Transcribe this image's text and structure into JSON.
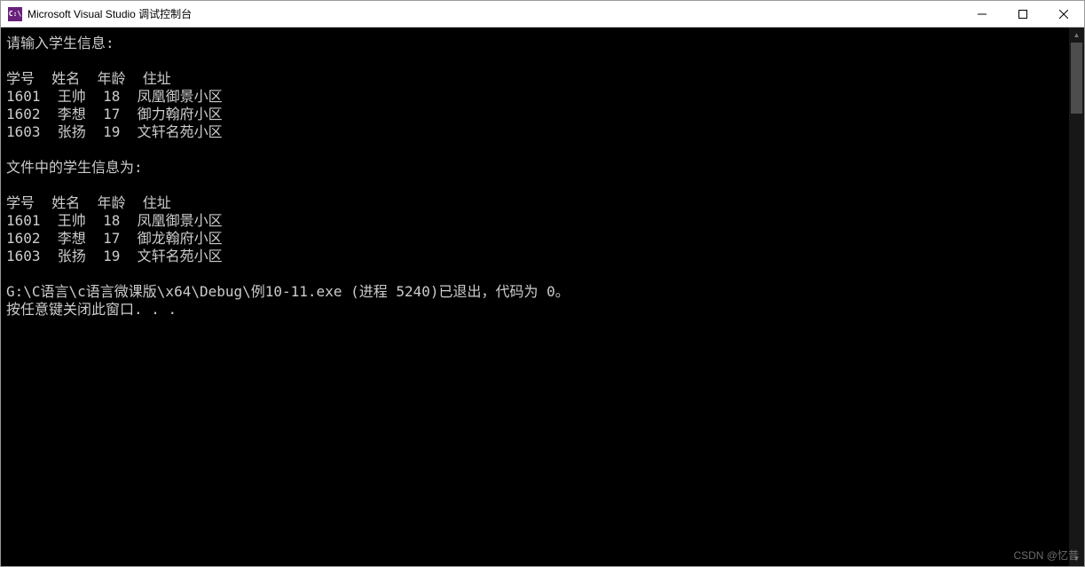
{
  "titlebar": {
    "icon_text": "C:\\",
    "title": "Microsoft Visual Studio 调试控制台"
  },
  "console": {
    "prompt_input": "请输入学生信息:",
    "blank": "",
    "header": "学号  姓名  年龄  住址",
    "row_input_1": "1601  王帅  18  凤凰御景小区",
    "row_input_2": "1602  李想  17  御力翰府小区",
    "row_input_3": "1603  张扬  19  文轩名苑小区",
    "prompt_file": "文件中的学生信息为:",
    "row_file_1": "1601  王帅  18  凤凰御景小区",
    "row_file_2": "1602  李想  17  御龙翰府小区",
    "row_file_3": "1603  张扬  19  文轩名苑小区",
    "exit_line": "G:\\C语言\\c语言微课版\\x64\\Debug\\例10-11.exe (进程 5240)已退出，代码为 0。",
    "press_key": "按任意键关闭此窗口. . ."
  },
  "watermark": "CSDN @忆昔"
}
